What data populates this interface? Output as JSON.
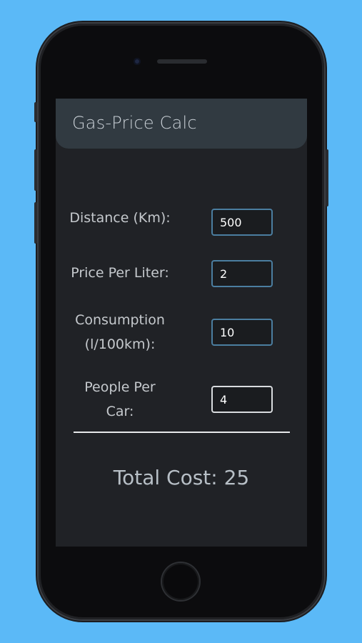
{
  "app": {
    "title": "Gas-Price Calc"
  },
  "form": {
    "distance": {
      "label": "Distance (Km):",
      "value": "500"
    },
    "price": {
      "label": "Price Per Liter:",
      "value": "2"
    },
    "consumption": {
      "label_line1": "Consumption",
      "label_line2": "(l/100km):",
      "value": "10"
    },
    "people": {
      "label_line1": "People Per",
      "label_line2": "Car:",
      "value": "4"
    }
  },
  "result": {
    "total_label": "Total Cost: 25"
  },
  "colors": {
    "background": "#5bb9f7",
    "screen": "#202226",
    "navbar": "#313a41",
    "field_border": "#4b7ea0",
    "field_border_active": "#d9dcdf"
  }
}
